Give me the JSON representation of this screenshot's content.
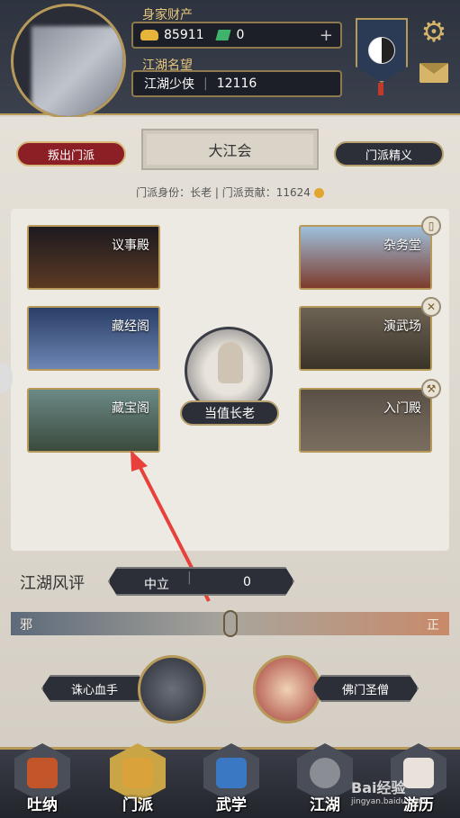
{
  "header": {
    "wealth_label": "身家财产",
    "gold": "85911",
    "jade": "0",
    "fame_label": "江湖名望",
    "title": "江湖少侠",
    "fame_value": "12116"
  },
  "sect": {
    "leave_label": "叛出门派",
    "name": "大江会",
    "essence_label": "门派精义",
    "info": "门派身份：长老 | 门派贡献：11624"
  },
  "halls": [
    {
      "label": "议事殿"
    },
    {
      "label": "藏经阁"
    },
    {
      "label": "藏宝阁"
    },
    {
      "label": "杂务堂"
    },
    {
      "label": "演武场"
    },
    {
      "label": "入门殿"
    }
  ],
  "elder": {
    "label": "当值长老"
  },
  "reputation": {
    "label": "江湖风评",
    "status": "中立",
    "value": "0",
    "left_end": "邪",
    "right_end": "正",
    "level": 0.5
  },
  "npcs": [
    {
      "label": "诛心血手"
    },
    {
      "label": "佛门圣僧"
    }
  ],
  "nav": [
    {
      "label": "吐纳"
    },
    {
      "label": "门派"
    },
    {
      "label": "武学"
    },
    {
      "label": "江湖"
    },
    {
      "label": "游历"
    }
  ],
  "watermark": {
    "main": "Bai经验",
    "sub": "jingyan.baidu.com"
  }
}
